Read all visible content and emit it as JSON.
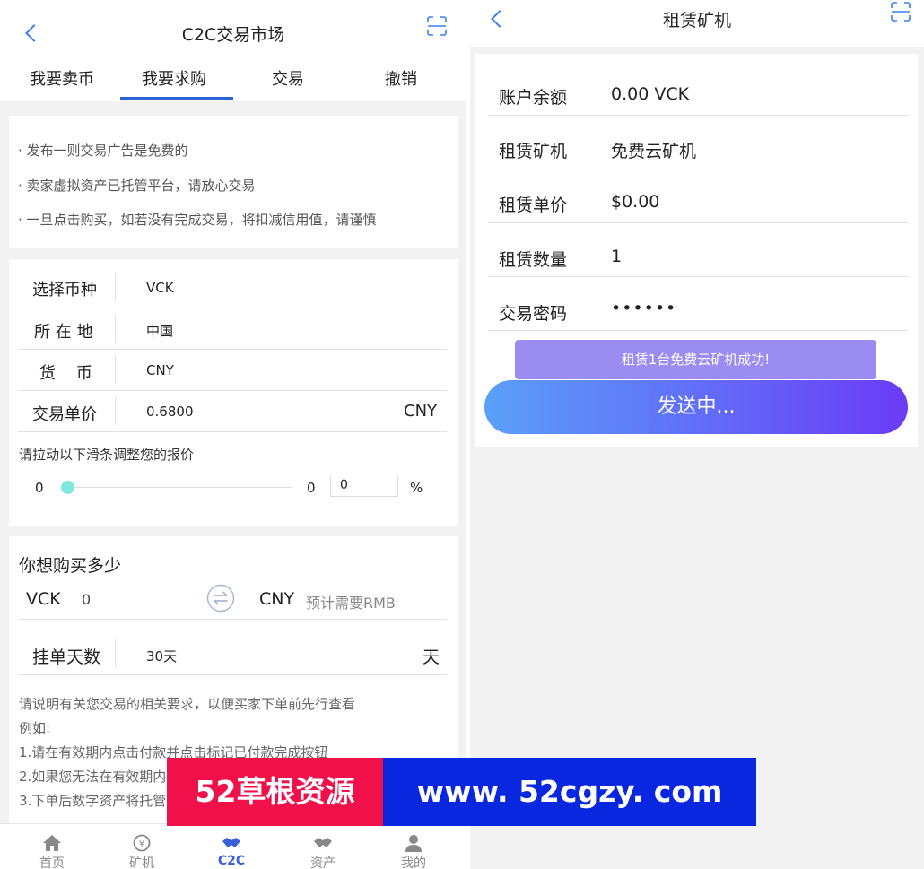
{
  "left": {
    "header": {
      "title": "C2C交易市场"
    },
    "tabs": [
      "我要卖币",
      "我要求购",
      "交易",
      "撤销"
    ],
    "active_tab_index": 1,
    "notices": [
      "· 发布一则交易广告是免费的",
      "· 卖家虚拟资产已托管平台，请放心交易",
      "· 一旦点击购买，如若没有完成交易，将扣减信用值，请谨慎"
    ],
    "form": {
      "coin": {
        "label": "选择币种",
        "value": "VCK"
      },
      "location": {
        "label": "所 在 地",
        "value": "中国"
      },
      "currency": {
        "label": "货    币",
        "value": "CNY"
      },
      "price": {
        "label": "交易单价",
        "value": "0.6800",
        "unit": "CNY"
      }
    },
    "slider": {
      "hint": "请拉动以下滑条调整您的报价",
      "min_label": "0",
      "value_label": "0",
      "input_value": "0",
      "percent": "%",
      "level": 0
    },
    "buy": {
      "title": "你想购买多少",
      "coin_unit": "VCK",
      "coin_amount": "0",
      "fiat_unit": "CNY",
      "fiat_placeholder": "预计需要RMB"
    },
    "days": {
      "label": "挂单天数",
      "value": "30天",
      "unit": "天"
    },
    "description": [
      "请说明有关您交易的相关要求，以便买家下单前先行查看",
      "例如:",
      "1.请在有效期内点击付款并点击标记已付款完成按钮",
      "2.如果您无法在有效期内",
      "3.下单后数字资产将托管"
    ],
    "bottom_nav": [
      {
        "label": "首页",
        "icon": "home-icon"
      },
      {
        "label": "矿机",
        "icon": "miner-icon"
      },
      {
        "label": "C2C",
        "icon": "handshake-icon",
        "active": true
      },
      {
        "label": "资产",
        "icon": "assets-icon"
      },
      {
        "label": "我的",
        "icon": "user-icon"
      }
    ]
  },
  "right": {
    "header": {
      "title": "租赁矿机"
    },
    "rows": [
      {
        "label": "账户余额",
        "value": "0.00 VCK"
      },
      {
        "label": "租赁矿机",
        "value": "免费云矿机"
      },
      {
        "label": "租赁单价",
        "value": "$0.00"
      },
      {
        "label": "租赁数量",
        "value": "1"
      },
      {
        "label": "交易密码",
        "value": "••••••"
      }
    ],
    "toast": "租赁1台免费云矿机成功!",
    "submit_label": "发送中..."
  },
  "watermark": {
    "brand": "52草根资源",
    "url": "www. 52cgzy. com",
    "brand_bg": "#f0104a",
    "url_bg": "#0a27e0"
  },
  "colors": {
    "accent": "#2a62d7",
    "back_arrow": "#3b7ff0",
    "slider_knob": "#7ee8dc",
    "nav_active": "#3a5fd9",
    "button_gradient_start": "#5aa0f8",
    "button_gradient_end": "#6a3cf7",
    "toast_bg": "#9b8ef0"
  }
}
